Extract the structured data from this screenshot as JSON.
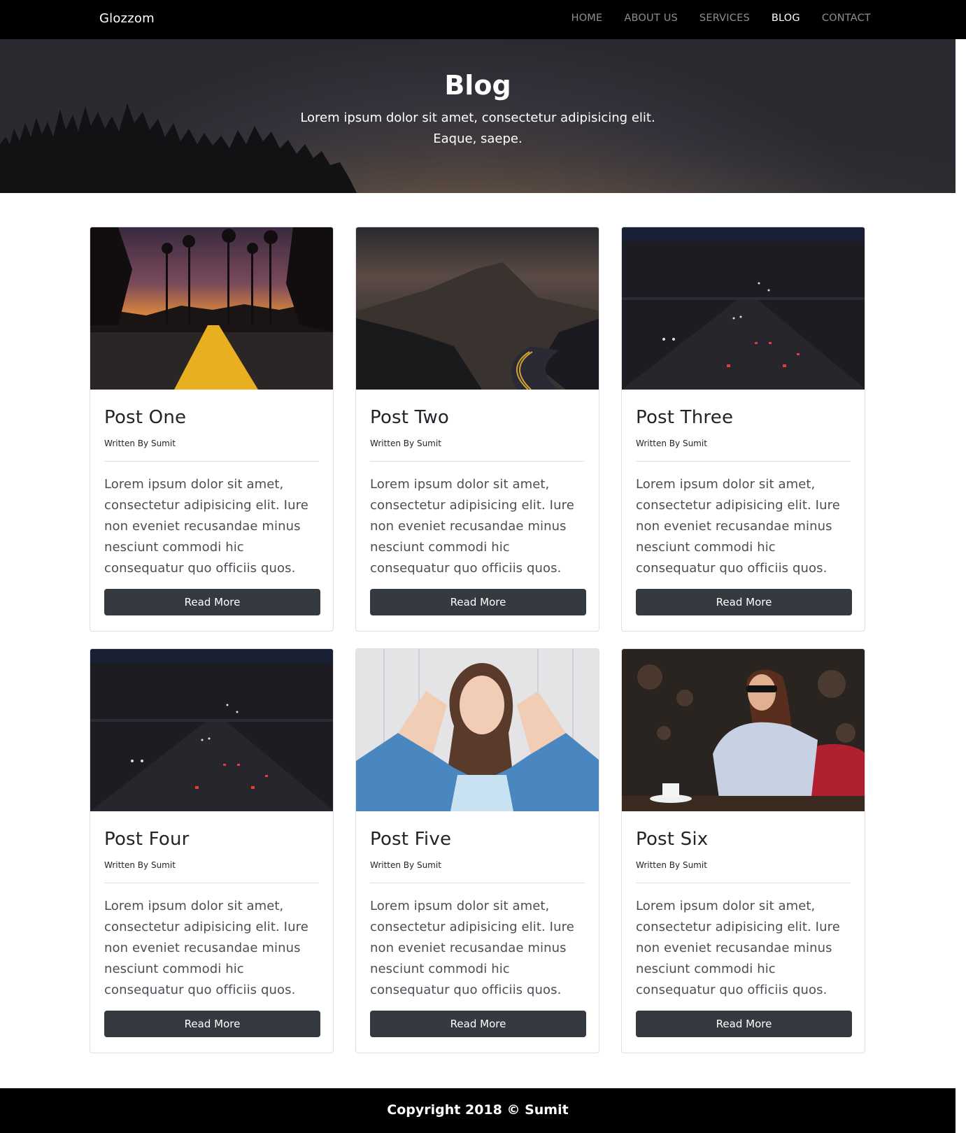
{
  "navbar": {
    "brand": "Glozzom",
    "links": [
      {
        "label": "HOME",
        "active": false
      },
      {
        "label": "ABOUT US",
        "active": false
      },
      {
        "label": "SERVICES",
        "active": false
      },
      {
        "label": "BLOG",
        "active": true
      },
      {
        "label": "CONTACT",
        "active": false
      }
    ]
  },
  "hero": {
    "title": "Blog",
    "subtitle": "Lorem ipsum dolor sit amet, consectetur adipisicing elit. Eaque, saepe."
  },
  "posts": [
    {
      "title": "Post One",
      "author": "Written By Sumit",
      "text": "Lorem ipsum dolor sit amet, consectetur adipisicing elit. Iure non eveniet recusandae minus nesciunt commodi hic consequatur quo officiis quos.",
      "button": "Read More",
      "image": "sunset-road-palms"
    },
    {
      "title": "Post Two",
      "author": "Written By Sumit",
      "text": "Lorem ipsum dolor sit amet, consectetur adipisicing elit. Iure non eveniet recusandae minus nesciunt commodi hic consequatur quo officiis quos.",
      "button": "Read More",
      "image": "mountain-road-night"
    },
    {
      "title": "Post Three",
      "author": "Written By Sumit",
      "text": "Lorem ipsum dolor sit amet, consectetur adipisicing elit. Iure non eveniet recusandae minus nesciunt commodi hic consequatur quo officiis quos.",
      "button": "Read More",
      "image": "city-traffic-night"
    },
    {
      "title": "Post Four",
      "author": "Written By Sumit",
      "text": "Lorem ipsum dolor sit amet, consectetur adipisicing elit. Iure non eveniet recusandae minus nesciunt commodi hic consequatur quo officiis quos.",
      "button": "Read More",
      "image": "city-traffic-night"
    },
    {
      "title": "Post Five",
      "author": "Written By Sumit",
      "text": "Lorem ipsum dolor sit amet, consectetur adipisicing elit. Iure non eveniet recusandae minus nesciunt commodi hic consequatur quo officiis quos.",
      "button": "Read More",
      "image": "woman-peace-sign"
    },
    {
      "title": "Post Six",
      "author": "Written By Sumit",
      "text": "Lorem ipsum dolor sit amet, consectetur adipisicing elit. Iure non eveniet recusandae minus nesciunt commodi hic consequatur quo officiis quos.",
      "button": "Read More",
      "image": "woman-cafe-sunglasses"
    }
  ],
  "footer": {
    "copyright": "Copyright 2018 © Sumit"
  },
  "colors": {
    "navbar_bg": "#000000",
    "button_bg": "#343a40",
    "footer_bg": "#000000"
  }
}
